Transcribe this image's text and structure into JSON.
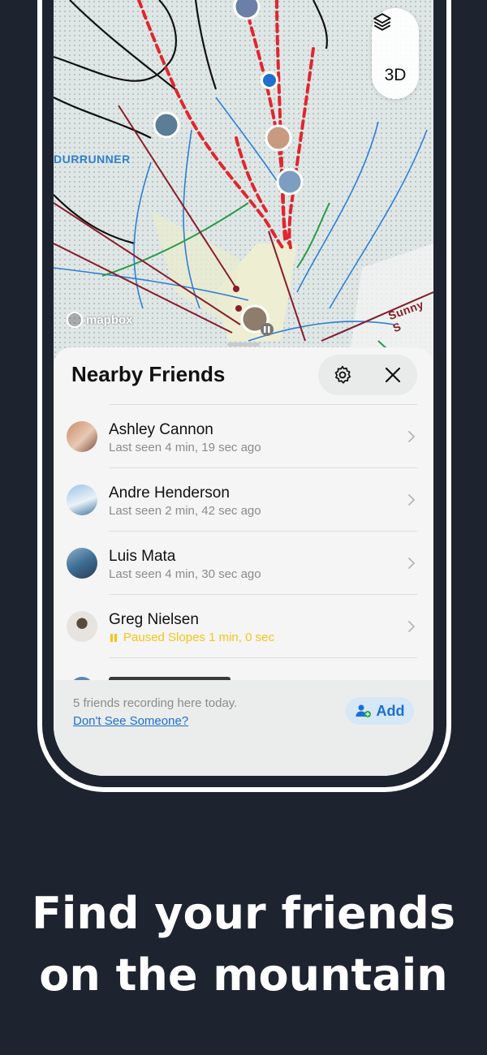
{
  "map": {
    "area_label": "DURRUNNER",
    "area_label2": "Sunny S",
    "attribution": "mapbox",
    "layers_icon": "layers-icon",
    "threed_label": "3D"
  },
  "sheet": {
    "title": "Nearby Friends",
    "settings_icon": "gear-icon",
    "close_icon": "close-icon",
    "friends": [
      {
        "name": "Ashley Cannon",
        "status": "Last seen 4 min, 19 sec ago",
        "paused": false
      },
      {
        "name": "Andre Henderson",
        "status": "Last seen 2 min, 42 sec ago",
        "paused": false
      },
      {
        "name": "Luis Mata",
        "status": "Last seen 4 min, 30 sec ago",
        "paused": false
      },
      {
        "name": "Greg Nielsen",
        "status": "Paused Slopes 1 min, 0 sec",
        "paused": true
      }
    ],
    "footer": {
      "summary": "5 friends recording here today.",
      "link": "Don't See Someone?",
      "add_label": "Add",
      "add_icon": "add-person-icon"
    }
  },
  "headline": {
    "line1": "Find your friends",
    "line2": "on the mountain"
  },
  "colors": {
    "background": "#1e2330",
    "accent_blue": "#1b6fd6",
    "paused_yellow": "#f5c518",
    "track_red": "#e0262f"
  }
}
